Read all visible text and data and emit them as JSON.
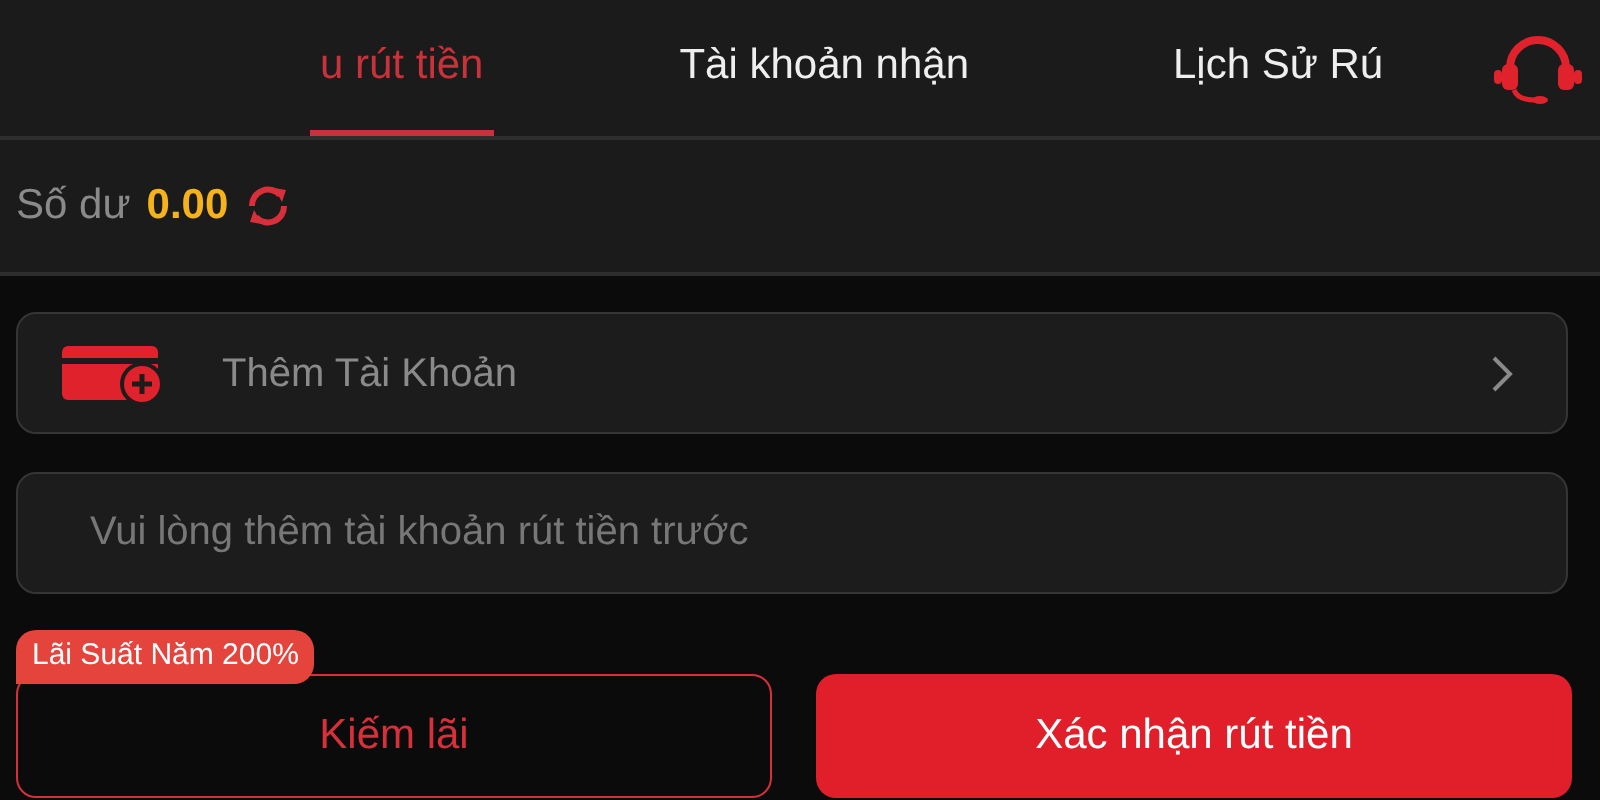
{
  "tabs": [
    {
      "label": "u rút tiền",
      "selected": true
    },
    {
      "label": "Tài khoản nhận",
      "selected": false
    },
    {
      "label": "Lịch Sử Rú",
      "selected": false
    }
  ],
  "balance": {
    "label": "Số dư",
    "amount": "0.00"
  },
  "add_account": {
    "label": "Thêm Tài Khoản"
  },
  "account_field": {
    "placeholder": "Vui lòng thêm tài khoản rút tiền trước"
  },
  "promo_badge": "Lãi Suất Năm 200%",
  "buttons": [
    {
      "label": "Kiếm lãi",
      "kind": "outline"
    },
    {
      "label": "Xác nhận rút tiền",
      "kind": "primary"
    }
  ]
}
